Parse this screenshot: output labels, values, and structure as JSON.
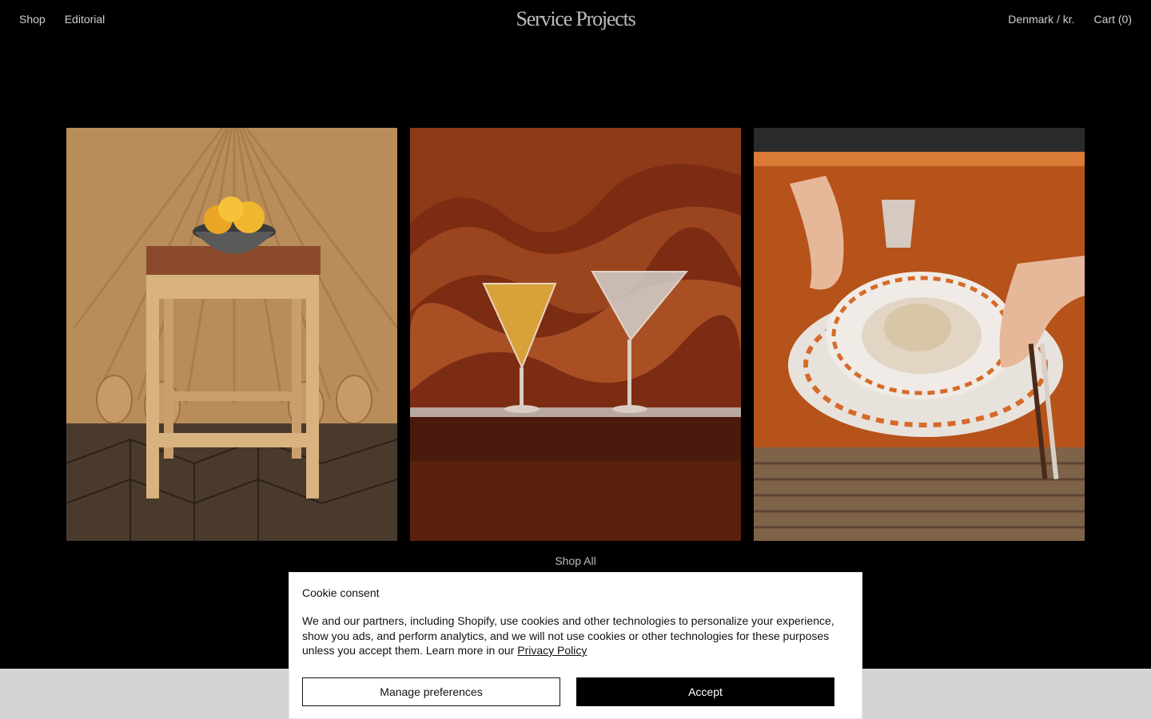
{
  "header": {
    "nav_left": [
      {
        "label": "Shop"
      },
      {
        "label": "Editorial"
      }
    ],
    "logo": "Service Projects",
    "locale": "Denmark / kr.",
    "cart": "Cart (0)"
  },
  "gallery": {
    "images": [
      {
        "icon": "stool-with-lemon-bowl-image"
      },
      {
        "icon": "cocktail-glasses-image"
      },
      {
        "icon": "noodle-plate-image"
      }
    ],
    "shop_all": "Shop All"
  },
  "cookie": {
    "title": "Cookie consent",
    "body": "We and our partners, including Shopify, use cookies and other technologies to personalize your experience, show you ads, and perform analytics, and we will not use cookies or other technologies for these purposes unless you accept them. Learn more in our ",
    "link": "Privacy Policy",
    "manage_label": "Manage preferences",
    "accept_label": "Accept"
  },
  "colors": {
    "background": "#000000",
    "footer_band": "#d4d4d4",
    "accent_button": "#000000"
  }
}
